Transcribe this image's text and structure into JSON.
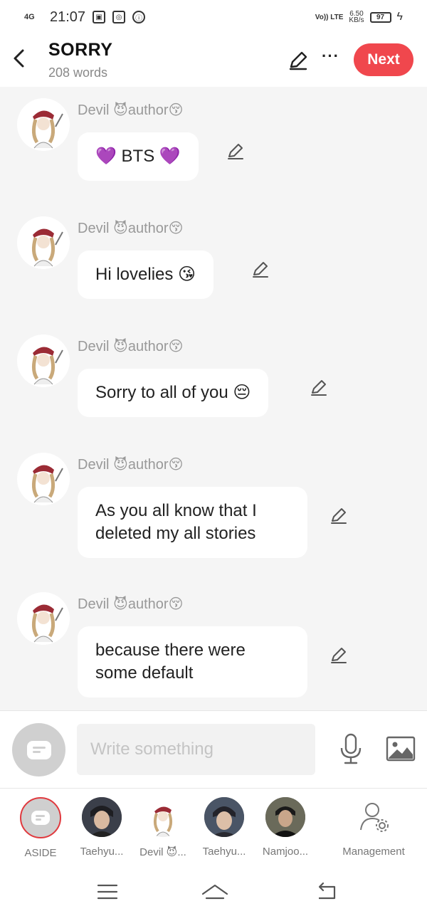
{
  "status_bar": {
    "network": "4G",
    "time": "21:07",
    "volte": "Vo)) LTE",
    "speed": "6.50",
    "speed_unit": "KB/s",
    "battery": "97"
  },
  "header": {
    "title": "SORRY",
    "word_count": "208 words",
    "next_label": "Next"
  },
  "messages": [
    {
      "author": "Devil 😈author😚",
      "text": "💜 BTS 💜"
    },
    {
      "author": "Devil 😈author😚",
      "text": "Hi lovelies 😘"
    },
    {
      "author": "Devil 😈author😚",
      "text": "Sorry to all of you 😔"
    },
    {
      "author": "Devil 😈author😚",
      "text": "As you all know that I deleted my all stories"
    },
    {
      "author": "Devil 😈author😚",
      "text": "because there were some default"
    }
  ],
  "composer": {
    "placeholder": "Write something"
  },
  "characters": [
    {
      "name": "ASIDE"
    },
    {
      "name": "Taehyu..."
    },
    {
      "name": "Devil 😈..."
    },
    {
      "name": "Taehyu..."
    },
    {
      "name": "Namjoo..."
    },
    {
      "name": "Management"
    }
  ],
  "colors": {
    "accent": "#f0474d",
    "chat_background": "#f5f5f5"
  }
}
